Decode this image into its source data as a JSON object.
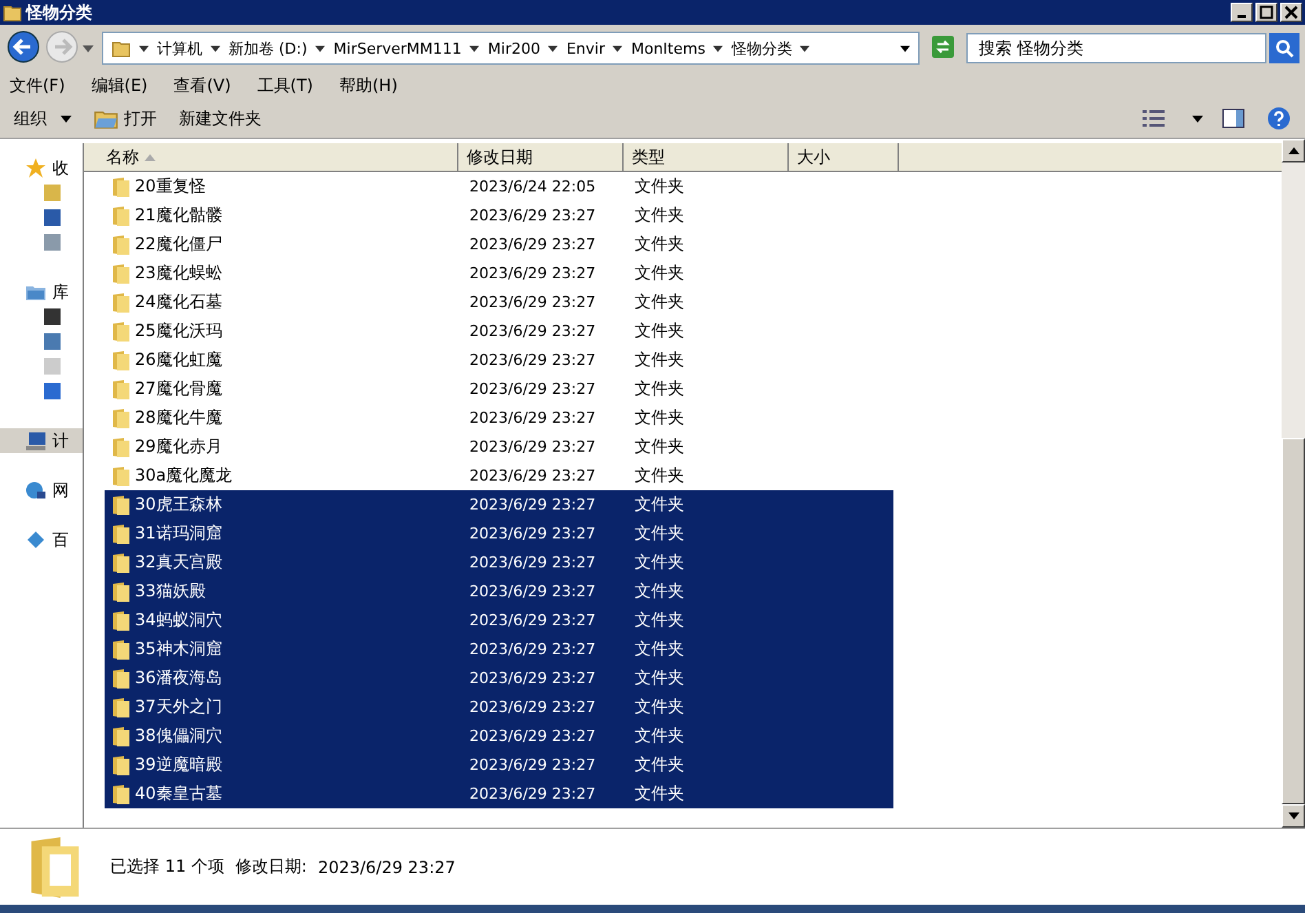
{
  "window": {
    "title": "怪物分类"
  },
  "address_bar": {
    "path": [
      "计算机",
      "新加卷 (D:)",
      "MirServerMM111",
      "Mir200",
      "Envir",
      "MonItems",
      "怪物分类"
    ]
  },
  "search": {
    "placeholder": "搜索 怪物分类"
  },
  "menu": [
    "文件(F)",
    "编辑(E)",
    "查看(V)",
    "工具(T)",
    "帮助(H)"
  ],
  "toolbar": [
    {
      "label": "组织",
      "kind": "menu"
    },
    {
      "label": "打开",
      "kind": "open"
    },
    {
      "label": "新建文件夹",
      "kind": "plain"
    }
  ],
  "sidebar": [
    {
      "label": "收",
      "kind": "star",
      "selected": false,
      "children": [
        {
          "kind": "download"
        },
        {
          "kind": "desktop"
        },
        {
          "kind": "recent"
        }
      ]
    },
    {
      "label": "库",
      "kind": "library",
      "selected": false,
      "children": [
        {
          "kind": "video"
        },
        {
          "kind": "image"
        },
        {
          "kind": "document"
        },
        {
          "kind": "music"
        }
      ]
    },
    {
      "label": "计",
      "kind": "computer",
      "selected": true
    },
    {
      "label": "网",
      "kind": "network",
      "selected": false
    },
    {
      "label": "百",
      "kind": "cloud",
      "selected": false
    }
  ],
  "columns": [
    {
      "label": "名称",
      "sorted": true
    },
    {
      "label": "修改日期",
      "sorted": false
    },
    {
      "label": "类型",
      "sorted": false
    },
    {
      "label": "大小",
      "sorted": false
    }
  ],
  "rows": [
    {
      "name": "20重复怪",
      "modified": "2023/6/24 22:05",
      "type": "文件夹",
      "selected": false
    },
    {
      "name": "21魔化骷髅",
      "modified": "2023/6/29 23:27",
      "type": "文件夹",
      "selected": false
    },
    {
      "name": "22魔化僵尸",
      "modified": "2023/6/29 23:27",
      "type": "文件夹",
      "selected": false
    },
    {
      "name": "23魔化蜈蚣",
      "modified": "2023/6/29 23:27",
      "type": "文件夹",
      "selected": false
    },
    {
      "name": "24魔化石墓",
      "modified": "2023/6/29 23:27",
      "type": "文件夹",
      "selected": false
    },
    {
      "name": "25魔化沃玛",
      "modified": "2023/6/29 23:27",
      "type": "文件夹",
      "selected": false
    },
    {
      "name": "26魔化虹魔",
      "modified": "2023/6/29 23:27",
      "type": "文件夹",
      "selected": false
    },
    {
      "name": "27魔化骨魔",
      "modified": "2023/6/29 23:27",
      "type": "文件夹",
      "selected": false
    },
    {
      "name": "28魔化牛魔",
      "modified": "2023/6/29 23:27",
      "type": "文件夹",
      "selected": false
    },
    {
      "name": "29魔化赤月",
      "modified": "2023/6/29 23:27",
      "type": "文件夹",
      "selected": false
    },
    {
      "name": "30a魔化魔龙",
      "modified": "2023/6/29 23:27",
      "type": "文件夹",
      "selected": false
    },
    {
      "name": "30虎王森林",
      "modified": "2023/6/29 23:27",
      "type": "文件夹",
      "selected": true
    },
    {
      "name": "31诺玛洞窟",
      "modified": "2023/6/29 23:27",
      "type": "文件夹",
      "selected": true
    },
    {
      "name": "32真天宫殿",
      "modified": "2023/6/29 23:27",
      "type": "文件夹",
      "selected": true
    },
    {
      "name": "33猫妖殿",
      "modified": "2023/6/29 23:27",
      "type": "文件夹",
      "selected": true
    },
    {
      "name": "34蚂蚁洞穴",
      "modified": "2023/6/29 23:27",
      "type": "文件夹",
      "selected": true
    },
    {
      "name": "35神木洞窟",
      "modified": "2023/6/29 23:27",
      "type": "文件夹",
      "selected": true
    },
    {
      "name": "36潘夜海岛",
      "modified": "2023/6/29 23:27",
      "type": "文件夹",
      "selected": true
    },
    {
      "name": "37天外之门",
      "modified": "2023/6/29 23:27",
      "type": "文件夹",
      "selected": true
    },
    {
      "name": "38傀儡洞穴",
      "modified": "2023/6/29 23:27",
      "type": "文件夹",
      "selected": true
    },
    {
      "name": "39逆魔暗殿",
      "modified": "2023/6/29 23:27",
      "type": "文件夹",
      "selected": true
    },
    {
      "name": "40秦皇古墓",
      "modified": "2023/6/29 23:27",
      "type": "文件夹",
      "selected": true
    }
  ],
  "status": {
    "summary": "已选择 11 个项",
    "modified_label": "修改日期:",
    "modified": "2023/6/29 23:27"
  }
}
